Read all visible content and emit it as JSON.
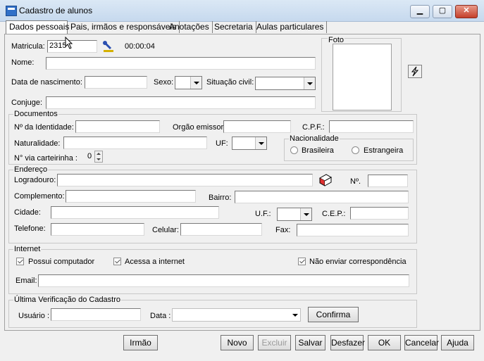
{
  "window": {
    "title": "Cadastro de alunos",
    "minimize": "▁",
    "maximize": "▢",
    "close": "✕"
  },
  "tabs": [
    {
      "label": "Dados pessoais"
    },
    {
      "label": "Pais, irmãos e responsáveis"
    },
    {
      "label": "Anotações"
    },
    {
      "label": "Secretaria"
    },
    {
      "label": "Aulas particulares"
    }
  ],
  "personal": {
    "matricula_label": "Matricula:",
    "matricula_value": "2315",
    "time": "00:00:04",
    "nome_label": "Nome:",
    "nascimento_label": "Data de nascimento:",
    "sexo_label": "Sexo:",
    "civil_label": "Situação civil:",
    "conjuge_label": "Conjuge:",
    "foto_label": "Foto"
  },
  "documentos": {
    "group_label": "Documentos",
    "identidade_label": "Nº da Identidade:",
    "orgao_label": "Orgão emissor:",
    "cpf_label": "C.P.F.:",
    "naturalidade_label": "Naturalidade:",
    "uf_label": "UF:",
    "carteirinha_label": "N° via carteirinha :",
    "carteirinha_value": "0",
    "nacionalidade_label": "Nacionalidade",
    "brasileira": "Brasileira",
    "estrangeira": "Estrangeira"
  },
  "endereco": {
    "group_label": "Endereço",
    "logradouro_label": "Logradouro:",
    "numero_label": "Nº.",
    "complemento_label": "Complemento:",
    "bairro_label": "Bairro:",
    "cidade_label": "Cidade:",
    "uf_label": "U.F.:",
    "cep_label": "C.E.P.:",
    "telefone_label": "Telefone:",
    "celular_label": "Celular:",
    "fax_label": "Fax:"
  },
  "internet": {
    "group_label": "Internet",
    "possui": "Possui computador",
    "acessa": "Acessa a internet",
    "nao_enviar": "Não enviar correspondência",
    "email_label": "Email:"
  },
  "verificacao": {
    "group_label": "Última Verificação do Cadastro",
    "usuario_label": "Usuário :",
    "data_label": "Data :",
    "confirma": "Confirma"
  },
  "buttons": {
    "irmao": "Irmão",
    "novo": "Novo",
    "excluir": "Excluir",
    "salvar": "Salvar",
    "desfazer": "Desfazer",
    "ok": "OK",
    "cancelar": "Cancelar",
    "ajuda": "Ajuda"
  }
}
